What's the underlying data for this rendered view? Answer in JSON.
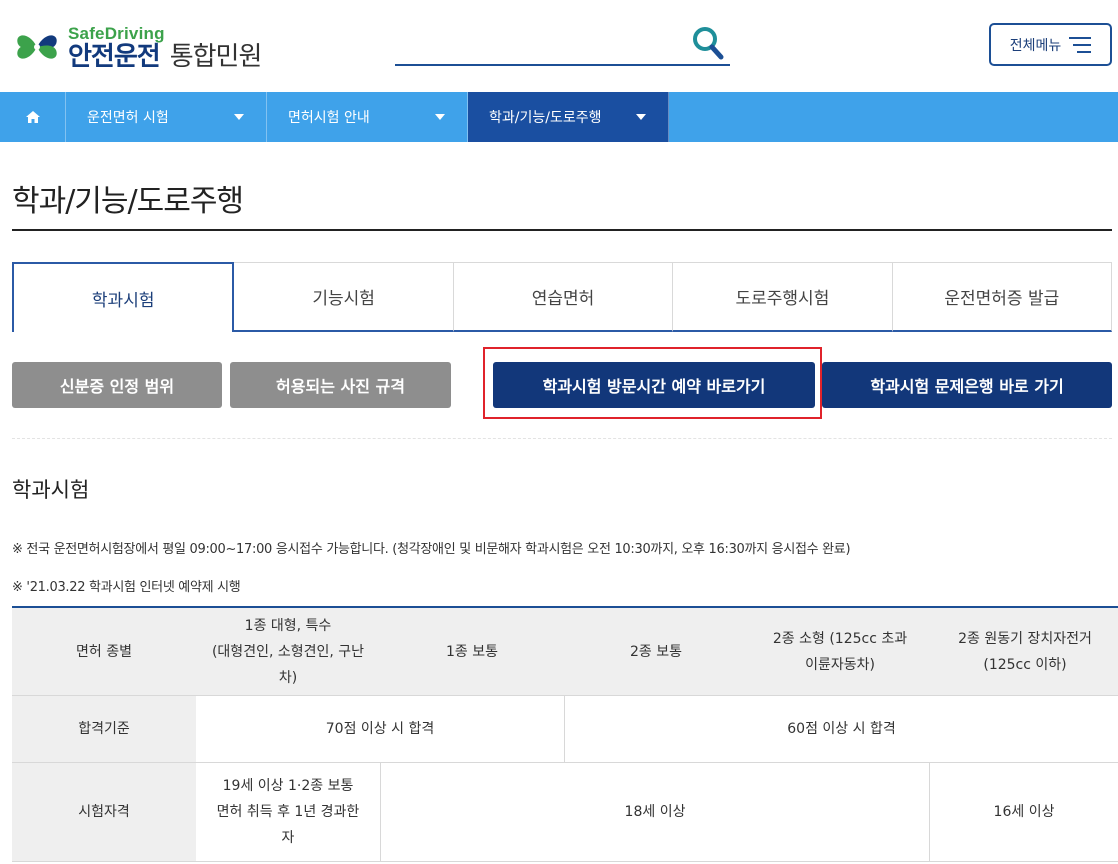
{
  "header": {
    "logo_en": "SafeDriving",
    "logo_kr_bold": "안전운전",
    "logo_kr_regular": "통합민원",
    "search_placeholder": "",
    "menu_label": "전체메뉴"
  },
  "nav": {
    "items": [
      {
        "label": "운전면허 시험"
      },
      {
        "label": "면허시험 안내"
      },
      {
        "label": "학과/기능/도로주행"
      }
    ]
  },
  "page": {
    "title": "학과/기능/도로주행"
  },
  "tabs": [
    {
      "label": "학과시험"
    },
    {
      "label": "기능시험"
    },
    {
      "label": "연습면허"
    },
    {
      "label": "도로주행시험"
    },
    {
      "label": "운전면허증 발급"
    }
  ],
  "buttons": {
    "id_scope": "신분증 인정 범위",
    "photo_rules": "허용되는 사진 규격",
    "reserve": "학과시험 방문시간 예약 바로가기",
    "question_bank": "학과시험 문제은행 바로 가기"
  },
  "section": {
    "title": "학과시험",
    "note1": "※ 전국 운전면허시험장에서 평일 09:00~17:00 응시접수 가능합니다. (청각장애인 및 비문해자 학과시험은 오전 10:30까지, 오후 16:30까지 응시접수 완료)",
    "note2": "※ '21.03.22 학과시험 인터넷 예약제 시행"
  },
  "table": {
    "headers": [
      "면허 종별",
      "1종 대형, 특수\n(대형견인, 소형견인, 구난차)",
      "1종 보통",
      "2종 보통",
      "2종 소형 (125cc 초과\n이륜자동차)",
      "2종 원동기 장치자전거\n(125cc 이하)"
    ],
    "row_pass": {
      "label": "합격기준",
      "group1": "70점 이상 시 합격",
      "group2": "60점 이상 시 합격"
    },
    "row_eligibility": {
      "label": "시험자격",
      "col1": "19세 이상 1·2종 보통 면허 취득 후 1년 경과한 자",
      "col_mid": "18세 이상",
      "col_last": "16세 이상"
    }
  },
  "colors": {
    "nav_bg": "#3fa2ea",
    "nav_active": "#1a4fa1",
    "navy_button": "#12377a",
    "gray_button": "#8e8e8e",
    "highlight": "#e0232b",
    "logo_green": "#3ca24b"
  }
}
